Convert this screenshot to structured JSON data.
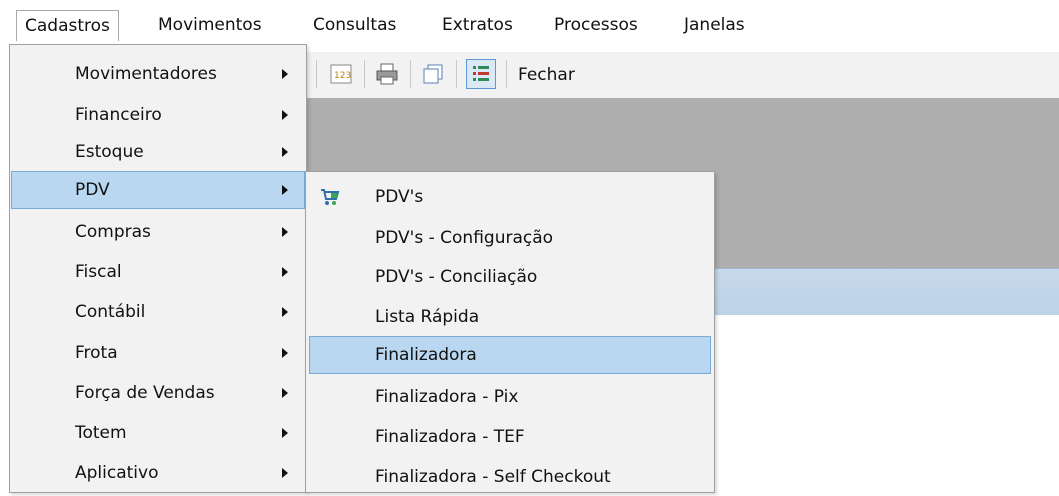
{
  "menubar": {
    "items": [
      "Cadastros",
      "Movimentos",
      "Consultas",
      "Extratos",
      "Processos",
      "Janelas"
    ]
  },
  "toolbar": {
    "close_label": "Fechar",
    "icons": [
      "sort-123-icon",
      "printer-icon",
      "copy-window-icon",
      "list-view-icon"
    ]
  },
  "cadastros_menu": {
    "items": [
      {
        "label": "Movimentadores",
        "submenu": true
      },
      {
        "label": "Financeiro",
        "submenu": true
      },
      {
        "label": "Estoque",
        "submenu": true
      },
      {
        "label": "PDV",
        "submenu": true,
        "selected": true
      },
      {
        "label": "Compras",
        "submenu": true
      },
      {
        "label": "Fiscal",
        "submenu": true
      },
      {
        "label": "Contábil",
        "submenu": true
      },
      {
        "label": "Frota",
        "submenu": true
      },
      {
        "label": "Força de Vendas",
        "submenu": true
      },
      {
        "label": "Totem",
        "submenu": true
      },
      {
        "label": "Aplicativo",
        "submenu": true
      }
    ]
  },
  "pdv_submenu": {
    "items": [
      {
        "label": "PDV's",
        "icon": "cart-icon"
      },
      {
        "label": "PDV's - Configuração"
      },
      {
        "label": "PDV's - Conciliação"
      },
      {
        "label": "Lista Rápida"
      },
      {
        "label": "Finalizadora",
        "selected": true
      },
      {
        "label": "Finalizadora - Pix"
      },
      {
        "label": "Finalizadora - TEF"
      },
      {
        "label": "Finalizadora - Self Checkout"
      }
    ]
  },
  "colors": {
    "highlight": "#bad7f1",
    "highlight_border": "#7aa9d6",
    "workspace_gray": "#aeaeae",
    "menu_bg": "#f2f2f2"
  }
}
